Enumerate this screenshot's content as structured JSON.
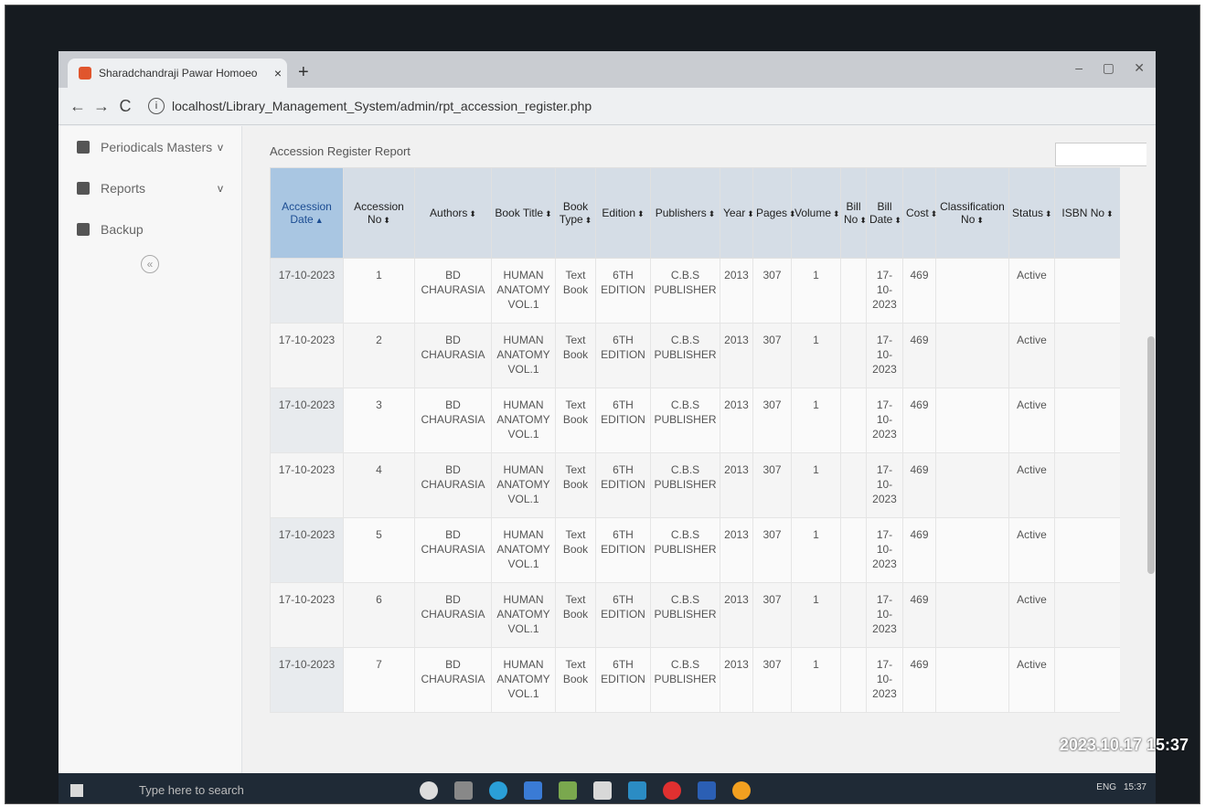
{
  "browser": {
    "tab_title": "Sharadchandraji Pawar Homoeo",
    "tab_close": "×",
    "new_tab": "+",
    "url": "localhost/Library_Management_System/admin/rpt_accession_register.php",
    "back": "←",
    "forward": "→",
    "reload": "C",
    "minimize": "–",
    "maximize": "▢",
    "close": "✕"
  },
  "sidebar": {
    "items": [
      {
        "label": "Periodicals Masters",
        "chev": "v"
      },
      {
        "label": "Reports",
        "chev": "v"
      },
      {
        "label": "Backup",
        "chev": ""
      }
    ],
    "collapse": "«"
  },
  "report": {
    "title": "Accession Register Report",
    "columns": [
      "Accession Date",
      "Accession No",
      "Authors",
      "Book Title",
      "Book Type",
      "Edition",
      "Publishers",
      "Year",
      "Pages",
      "Volume",
      "Bill No",
      "Bill Date",
      "Cost",
      "Classification No",
      "Status",
      "ISBN No"
    ],
    "rows": [
      [
        "17-10-2023",
        "1",
        "BD CHAURASIA",
        "HUMAN ANATOMY VOL.1",
        "Text Book",
        "6TH EDITION",
        "C.B.S PUBLISHER",
        "2013",
        "307",
        "1",
        "",
        "17-10-2023",
        "469",
        "",
        "Active",
        ""
      ],
      [
        "17-10-2023",
        "2",
        "BD CHAURASIA",
        "HUMAN ANATOMY VOL.1",
        "Text Book",
        "6TH EDITION",
        "C.B.S PUBLISHER",
        "2013",
        "307",
        "1",
        "",
        "17-10-2023",
        "469",
        "",
        "Active",
        ""
      ],
      [
        "17-10-2023",
        "3",
        "BD CHAURASIA",
        "HUMAN ANATOMY VOL.1",
        "Text Book",
        "6TH EDITION",
        "C.B.S PUBLISHER",
        "2013",
        "307",
        "1",
        "",
        "17-10-2023",
        "469",
        "",
        "Active",
        ""
      ],
      [
        "17-10-2023",
        "4",
        "BD CHAURASIA",
        "HUMAN ANATOMY VOL.1",
        "Text Book",
        "6TH EDITION",
        "C.B.S PUBLISHER",
        "2013",
        "307",
        "1",
        "",
        "17-10-2023",
        "469",
        "",
        "Active",
        ""
      ],
      [
        "17-10-2023",
        "5",
        "BD CHAURASIA",
        "HUMAN ANATOMY VOL.1",
        "Text Book",
        "6TH EDITION",
        "C.B.S PUBLISHER",
        "2013",
        "307",
        "1",
        "",
        "17-10-2023",
        "469",
        "",
        "Active",
        ""
      ],
      [
        "17-10-2023",
        "6",
        "BD CHAURASIA",
        "HUMAN ANATOMY VOL.1",
        "Text Book",
        "6TH EDITION",
        "C.B.S PUBLISHER",
        "2013",
        "307",
        "1",
        "",
        "17-10-2023",
        "469",
        "",
        "Active",
        ""
      ],
      [
        "17-10-2023",
        "7",
        "BD CHAURASIA",
        "HUMAN ANATOMY VOL.1",
        "Text Book",
        "6TH EDITION",
        "C.B.S PUBLISHER",
        "2013",
        "307",
        "1",
        "",
        "17-10-2023",
        "469",
        "",
        "Active",
        ""
      ]
    ]
  },
  "taskbar": {
    "search_placeholder": "Type here to search",
    "tray_lang": "ENG",
    "tray_time": "15:37"
  },
  "photo_stamp": "2023.10.17 15:37",
  "colors": {
    "header_bg": "#d5dde6",
    "sorted_header_bg": "#a9c6e2",
    "sorted_header_text": "#1b4c92"
  }
}
